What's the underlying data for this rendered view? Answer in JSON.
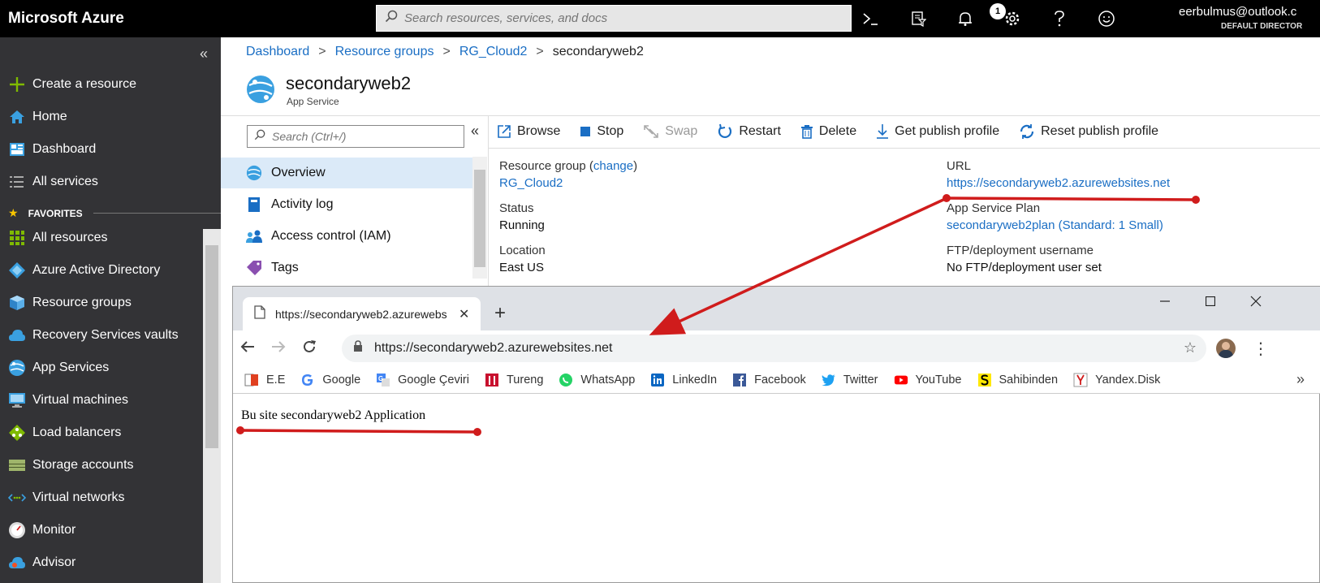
{
  "topbar": {
    "brand": "Microsoft Azure",
    "search_placeholder": "Search resources, services, and docs",
    "notification_count": "1",
    "user_email": "eerbulmus@outlook.c",
    "user_directory": "DEFAULT DIRECTOR"
  },
  "leftnav": {
    "collapse_label": "«",
    "create": "Create a resource",
    "home": "Home",
    "dashboard": "Dashboard",
    "all_services": "All services",
    "favorites_header": "FAVORITES",
    "items": [
      "All resources",
      "Azure Active Directory",
      "Resource groups",
      "Recovery Services vaults",
      "App Services",
      "Virtual machines",
      "Load balancers",
      "Storage accounts",
      "Virtual networks",
      "Monitor",
      "Advisor"
    ]
  },
  "breadcrumb": {
    "items": [
      "Dashboard",
      "Resource groups",
      "RG_Cloud2"
    ],
    "current": "secondaryweb2",
    "sep": ">"
  },
  "resource": {
    "title": "secondaryweb2",
    "subtitle": "App Service"
  },
  "resmenu": {
    "search_placeholder": "Search (Ctrl+/)",
    "collapse_label": "«",
    "items": [
      "Overview",
      "Activity log",
      "Access control (IAM)",
      "Tags"
    ]
  },
  "commands": {
    "browse": "Browse",
    "stop": "Stop",
    "swap": "Swap",
    "restart": "Restart",
    "delete": "Delete",
    "get_publish_profile": "Get publish profile",
    "reset_publish_profile": "Reset publish profile"
  },
  "essentials": {
    "resource_group_label": "Resource group (",
    "resource_group_change": "change",
    "resource_group_close": ")",
    "resource_group_value": "RG_Cloud2",
    "status_label": "Status",
    "status_value": "Running",
    "location_label": "Location",
    "location_value": "East US",
    "url_label": "URL",
    "url_value": "https://secondaryweb2.azurewebsites.net",
    "plan_label": "App Service Plan",
    "plan_value": "secondaryweb2plan (Standard: 1 Small)",
    "ftp_label": "FTP/deployment username",
    "ftp_value": "No FTP/deployment user set"
  },
  "browser": {
    "tab_title": "https://secondaryweb2.azurewebs",
    "url": "https://secondaryweb2.azurewebsites.net",
    "bookmarks": [
      "E.E",
      "Google",
      "Google Çeviri",
      "Tureng",
      "WhatsApp",
      "LinkedIn",
      "Facebook",
      "Twitter",
      "YouTube",
      "Sahibinden",
      "Yandex.Disk"
    ],
    "bookmarks_more": "»",
    "page_text": "Bu site secondaryweb2 Application"
  },
  "colors": {
    "azure_blue": "#1a6ec4",
    "annotation_red": "#d01c1c",
    "nav_bg": "#333336"
  }
}
